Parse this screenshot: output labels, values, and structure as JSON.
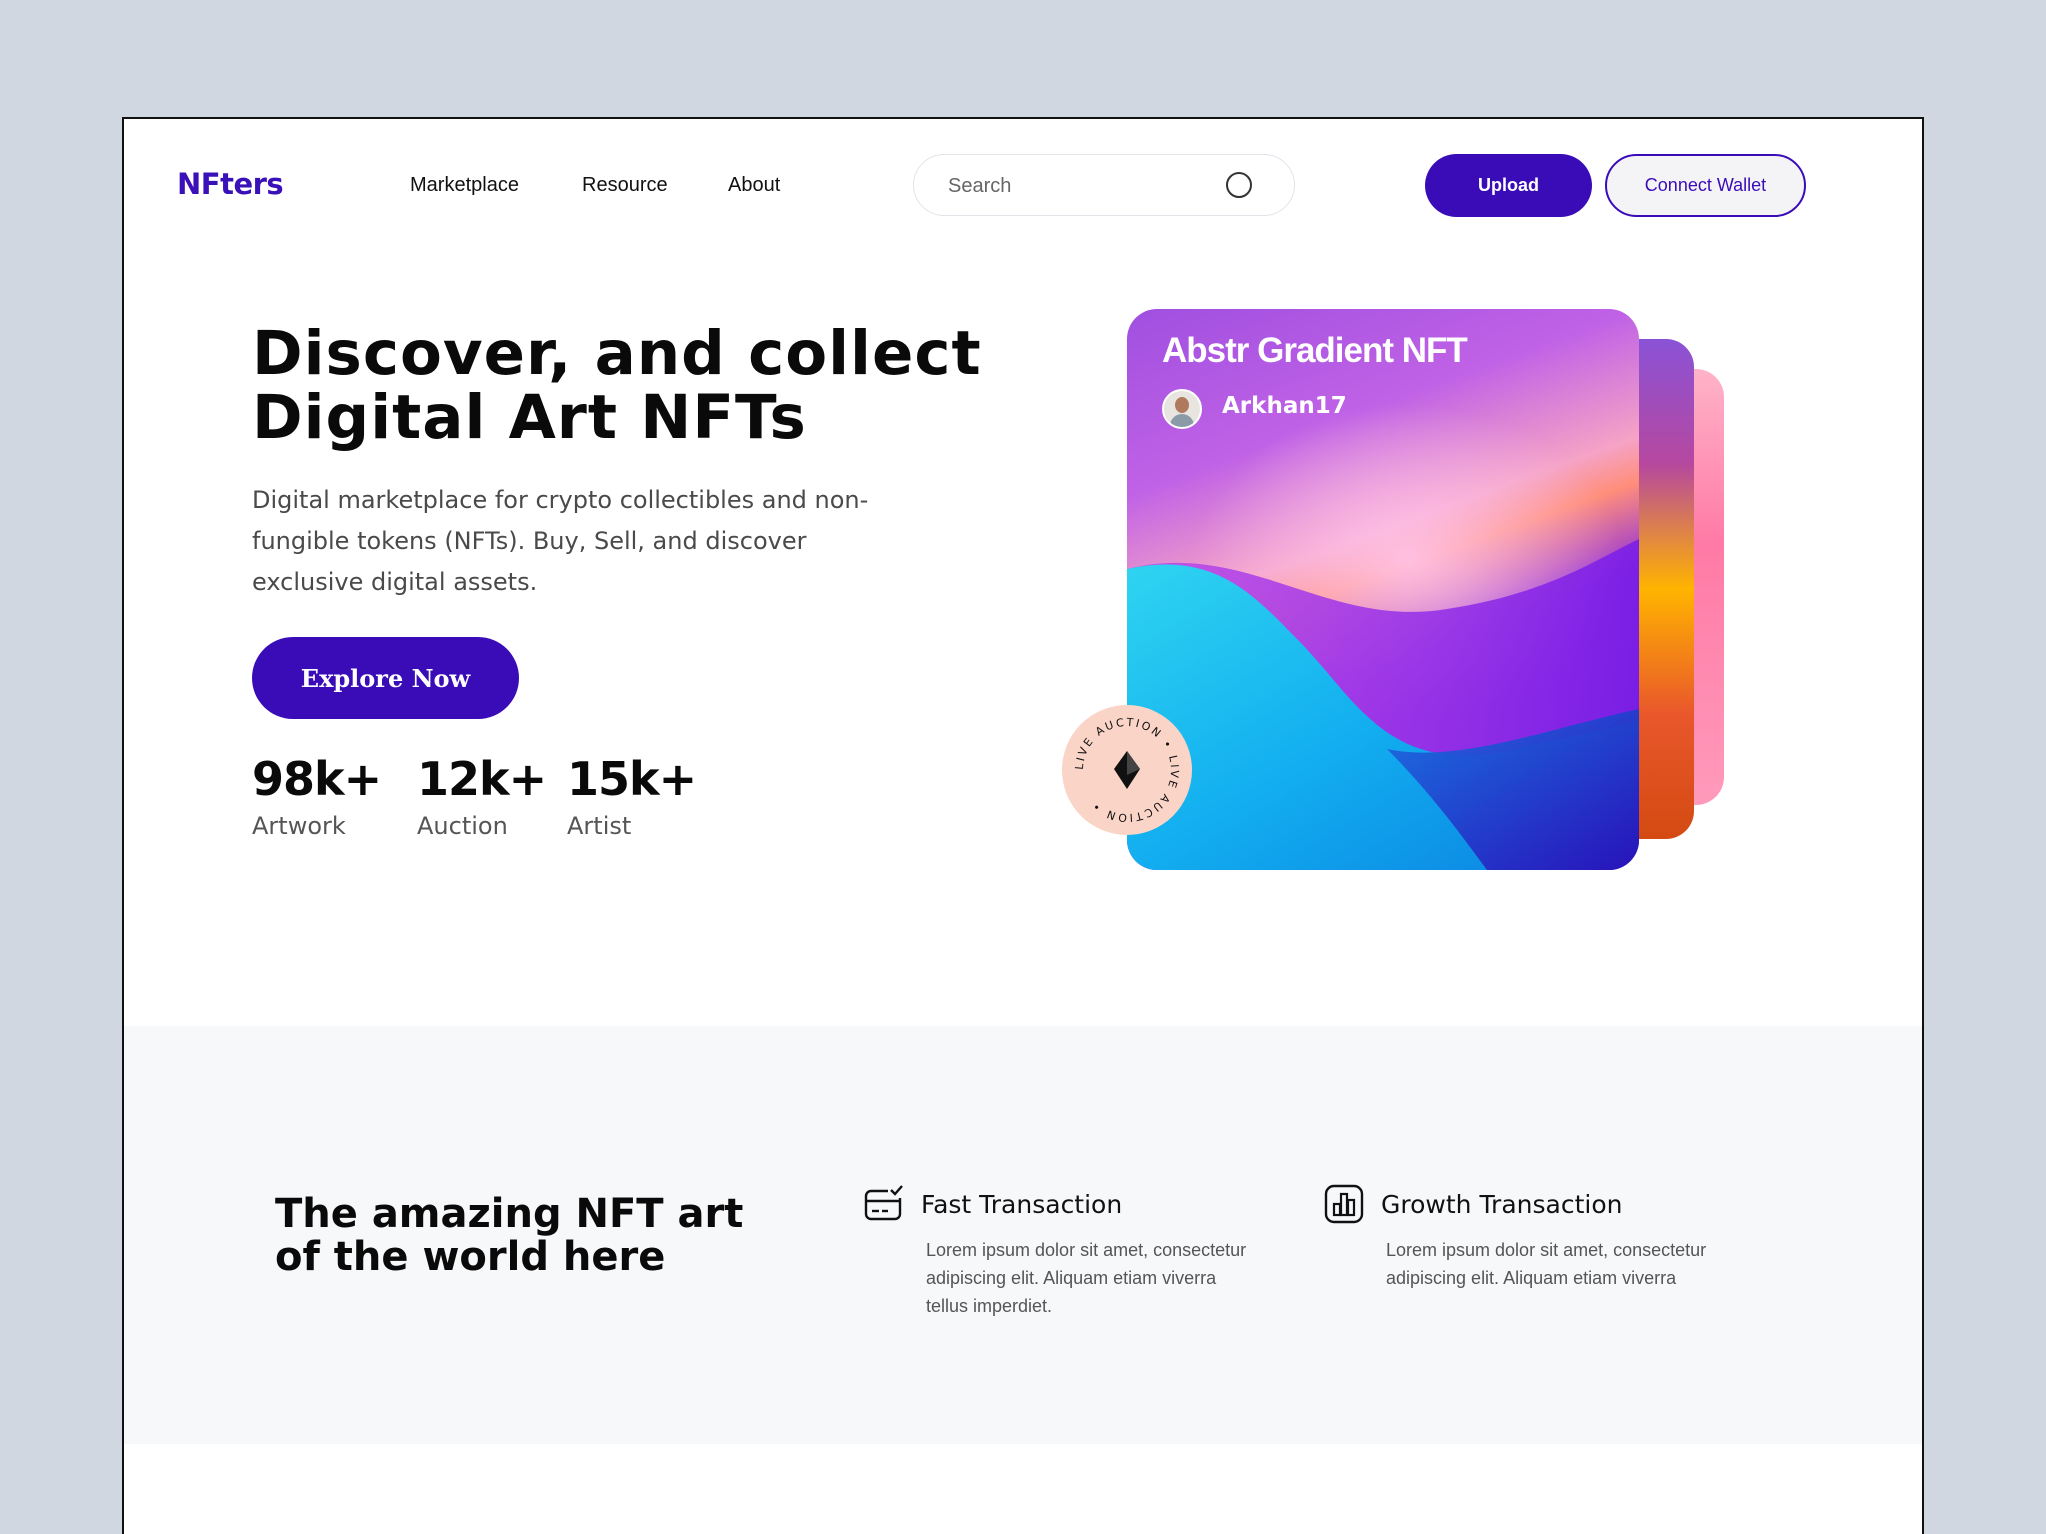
{
  "header": {
    "logo": "NFters",
    "nav": [
      "Marketplace",
      "Resource",
      "About"
    ],
    "search_placeholder": "Search",
    "upload_label": "Upload",
    "connect_label": "Connect Wallet"
  },
  "hero": {
    "title_line1": "Discover, and collect",
    "title_line2": "Digital Art NFTs",
    "description": "Digital marketplace for crypto collectibles and non-fungible tokens (NFTs). Buy, Sell, and discover exclusive digital assets.",
    "cta_label": "Explore Now",
    "stats": [
      {
        "value": "98k+",
        "label": "Artwork"
      },
      {
        "value": "12k+",
        "label": "Auction"
      },
      {
        "value": "15k+",
        "label": "Artist"
      }
    ]
  },
  "nft_card": {
    "title": "Abstr Gradient NFT",
    "author": "Arkhan17",
    "badge_text": "LIVE AUCTION • LIVE AUCTION •"
  },
  "features": {
    "title_line1": "The amazing NFT art",
    "title_line2": "of the world here",
    "items": [
      {
        "icon": "card-check-icon",
        "title": "Fast Transaction",
        "text": "Lorem ipsum dolor sit amet, consectetur adipiscing elit. Aliquam etiam viverra tellus imperdiet."
      },
      {
        "icon": "bar-chart-icon",
        "title": "Growth Transaction",
        "text": "Lorem ipsum dolor sit amet, consectetur adipiscing elit. Aliquam etiam viverra"
      }
    ]
  },
  "colors": {
    "brand": "#3a0cb8",
    "page_bg": "#d1d7e1",
    "band_bg": "#f7f8fa"
  }
}
